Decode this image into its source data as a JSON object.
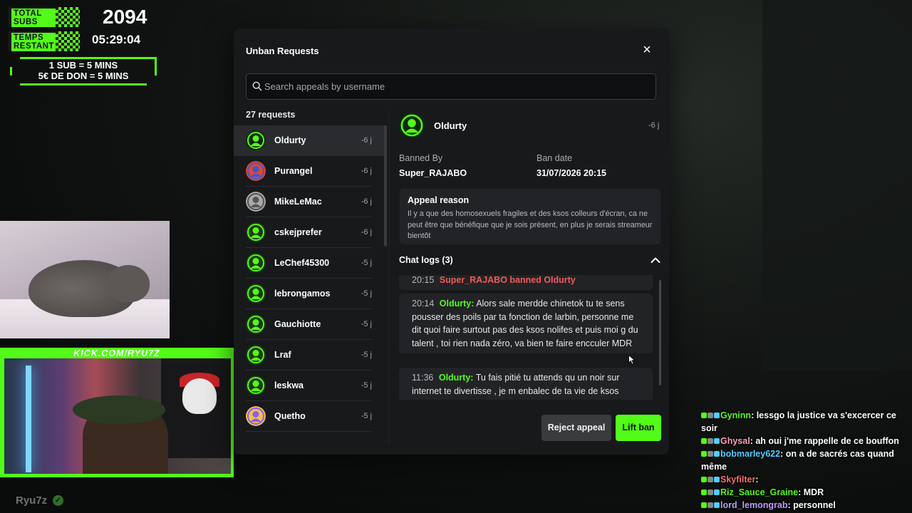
{
  "overlay": {
    "total_subs_label": "TOTAL SUBS",
    "total_subs_value": "2094",
    "time_label": "TEMPS RESTANT",
    "time_value": "05:29:04",
    "rule_line1": "1 SUB = 5 MINS",
    "rule_line2": "5€ DE DON = 5 MINS",
    "cam_url": "KICK.COM/RYU7Z",
    "streamer_name": "Ryu7z"
  },
  "stream_chat": [
    {
      "user": "Gyninn",
      "text": "lessgo la justice va s'excercer ce soir",
      "color": "#53fc18"
    },
    {
      "user": "Ghysal",
      "text": "ah oui j'me rappelle de ce bouffon",
      "color": "#ff9eb6"
    },
    {
      "user": "bobmarley622",
      "text": "on a de sacrés cas quand même",
      "color": "#4fd0ff"
    },
    {
      "user": "Skyfilter",
      "text": "",
      "color": "#ff6b6b"
    },
    {
      "user": "Riz_Sauce_Graine",
      "text": "MDR",
      "color": "#53fc18"
    },
    {
      "user": "lord_lemongrab",
      "text": "personnel",
      "color": "#c49bff"
    }
  ],
  "modal": {
    "title": "Unban Requests",
    "close_label": "×",
    "search_placeholder": "Search appeals by username",
    "request_count": "27 requests",
    "requests": [
      {
        "name": "Oldurty",
        "age": "-6 j"
      },
      {
        "name": "Purangel",
        "age": "-6 j"
      },
      {
        "name": "MikeLeMac",
        "age": "-6 j"
      },
      {
        "name": "cskejprefer",
        "age": "-6 j"
      },
      {
        "name": "LeChef45300",
        "age": "-5 j"
      },
      {
        "name": "lebrongamos",
        "age": "-5 j"
      },
      {
        "name": "Gauchiotte",
        "age": "-5 j"
      },
      {
        "name": "Lraf",
        "age": "-5 j"
      },
      {
        "name": "leskwa",
        "age": "-5 j"
      },
      {
        "name": "Quetho",
        "age": "-5 j"
      }
    ],
    "detail": {
      "name": "Oldurty",
      "age": "-6 j",
      "banned_by_label": "Banned By",
      "banned_by": "Super_RAJABO",
      "ban_date_label": "Ban date",
      "ban_date": "31/07/2026 20:15",
      "appeal_title": "Appeal reason",
      "appeal_text": "Il y a que des homosexuels fragiles et des ksos colleurs d'écran, ca ne peut être que bénéfique que je sois présent, en plus je serais streameur bientôt",
      "chat_logs_label": "Chat logs (3)",
      "logs": [
        {
          "time": "20:15",
          "user": "",
          "text": "Super_RAJABO banned Oldurty"
        },
        {
          "time": "20:14",
          "user": "Oldurty",
          "text": "Alors sale merdde chinetok tu te sens pousser des poils par ta fonction de larbin, personne me dit quoi faire surtout pas des ksos nolifes et puis moi g du talent , toi rien nada zéro, va bien te faire encculer MDR"
        },
        {
          "time": "11:36",
          "user": "Oldurty",
          "text": "Tu fais pitié tu attends qu un noir sur internet te divertisse , je m enbalec de ta vie de ksos"
        }
      ]
    },
    "reject_label": "Reject appeal",
    "lift_label": "Lift ban"
  },
  "colors": {
    "accent": "#53fc18",
    "modal_bg": "#18191b",
    "danger": "#ef5b5b"
  }
}
